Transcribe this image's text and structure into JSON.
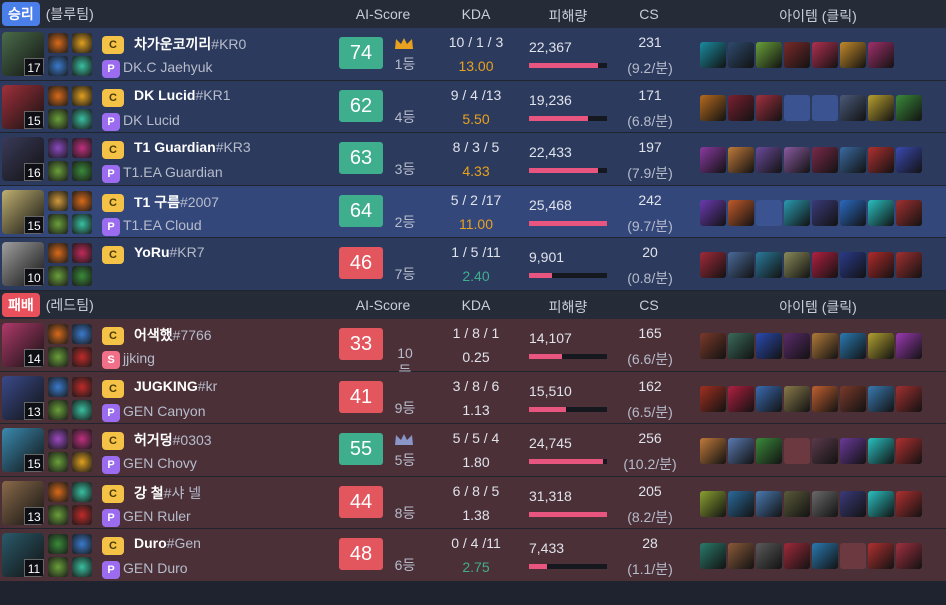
{
  "blue_team": {
    "result": "승리",
    "label": "(블루팀)",
    "headers": {
      "ai": "AI-Score",
      "kda": "KDA",
      "dmg": "피해량",
      "cs": "CS",
      "items": "아이템 (클릭)"
    },
    "players": [
      {
        "level": "17",
        "tier": "C",
        "name": "차가운코끼리",
        "tag": "#KR0",
        "subtier": "P",
        "sub": "DK.C Jaehyuk",
        "score": "74",
        "rank": "1등",
        "crown": "gold",
        "kda": "10 / 1 / 3",
        "ratio": "13.00",
        "ratio_color": "#e8a21f",
        "dmg": "22,367",
        "dmg_frac": 0.88,
        "cs": "231",
        "csm": "(9.2/분)",
        "me": false,
        "items": [
          "#1a8ca0",
          "#2e4a6e",
          "#6aa03a",
          "#7a2a2a",
          "#b03050",
          "#c28a2a",
          "#a0306a"
        ],
        "champ": "#4a6c4a",
        "spells": [
          "#d86a1a",
          "#e0a020",
          "#3a7acc",
          "#3ac0a0"
        ]
      },
      {
        "level": "15",
        "tier": "C",
        "name": "DK Lucid",
        "tag": "#KR1",
        "subtier": "P",
        "sub": "DK Lucid",
        "score": "62",
        "rank": "4등",
        "crown": "",
        "kda": "9 / 4 /13",
        "ratio": "5.50",
        "ratio_color": "#e8a21f",
        "dmg": "19,236",
        "dmg_frac": 0.75,
        "cs": "171",
        "csm": "(6.8/분)",
        "me": false,
        "items": [
          "#b46a1e",
          "#7a2030",
          "#a03040",
          "blank",
          "blank",
          "#4a5a7a",
          "#b8a030",
          "#3a8a3a"
        ],
        "champ": "#a0303a",
        "spells": [
          "#d86a1a",
          "#e0a020",
          "#6aa03a",
          "#3ac0a0"
        ]
      },
      {
        "level": "16",
        "tier": "C",
        "name": "T1 Guardian",
        "tag": "#KR3",
        "subtier": "P",
        "sub": "T1.EA Guardian",
        "score": "63",
        "rank": "3등",
        "crown": "",
        "kda": "8 / 3 / 5",
        "ratio": "4.33",
        "ratio_color": "#e8a21f",
        "dmg": "22,433",
        "dmg_frac": 0.88,
        "cs": "197",
        "csm": "(7.9/분)",
        "me": false,
        "items": [
          "#8a3aa0",
          "#c07a3a",
          "#6a4a9a",
          "#8a5aa0",
          "#7a2a4a",
          "#3a6aa0",
          "#b03030",
          "#3a4ab0"
        ],
        "champ": "#3a3a5a",
        "spells": [
          "#8a4ac0",
          "#c03080",
          "#6aa03a",
          "#3a8a3a"
        ]
      },
      {
        "level": "15",
        "tier": "C",
        "name": "T1 구름",
        "tag": "#2007",
        "subtier": "P",
        "sub": "T1.EA Cloud",
        "score": "64",
        "rank": "2등",
        "crown": "",
        "kda": "5 / 2 /17",
        "ratio": "11.00",
        "ratio_color": "#e8a21f",
        "dmg": "25,468",
        "dmg_frac": 1.0,
        "cs": "242",
        "csm": "(9.7/분)",
        "me": true,
        "items": [
          "#6a3ab0",
          "#c05a2a",
          "blank",
          "#2a9ab0",
          "#3a3a7a",
          "#2a6ac0",
          "#2ac0c0",
          "#a03030"
        ],
        "champ": "#c0b070",
        "spells": [
          "#d09a3a",
          "#d86a1a",
          "#6aa03a",
          "#3ac0a0"
        ]
      },
      {
        "level": "10",
        "tier": "C",
        "name": "YoRu",
        "tag": "#KR7",
        "subtier": "",
        "sub": "",
        "score": "46",
        "rank": "7등",
        "crown": "",
        "kda": "1 / 5 /11",
        "ratio": "2.40",
        "ratio_color": "#3fae8d",
        "dmg": "9,901",
        "dmg_frac": 0.3,
        "cs": "20",
        "csm": "(0.8/분)",
        "me": false,
        "items": [
          "#a02a3a",
          "#4a6a9a",
          "#2a7a9a",
          "#8a8a5a",
          "#b02040",
          "#2a3a8a",
          "#b02a2a",
          "#a03030"
        ],
        "champ": "#a0a0a0",
        "spells": [
          "#d86a1a",
          "#c02a5a",
          "#6aa03a",
          "#3a8a3a"
        ]
      }
    ]
  },
  "red_team": {
    "result": "패배",
    "label": "(레드팀)",
    "headers": {
      "ai": "AI-Score",
      "kda": "KDA",
      "dmg": "피해량",
      "cs": "CS",
      "items": "아이템 (클릭)"
    },
    "players": [
      {
        "level": "14",
        "tier": "C",
        "name": "어색했",
        "tag": "#7766",
        "subtier": "S",
        "sub": "jjking",
        "score": "33",
        "rank": "10등",
        "crown": "",
        "kda": "1 / 8 / 1",
        "ratio": "0.25",
        "ratio_color": "#e0e3ea",
        "dmg": "14,107",
        "dmg_frac": 0.42,
        "cs": "165",
        "csm": "(6.6/분)",
        "me": false,
        "items": [
          "#7a3a2a",
          "#3a6a5a",
          "#2a4ab0",
          "#5a2a6a",
          "#b07a3a",
          "#2a7ab0",
          "#b0a030",
          "#9a3ab0"
        ],
        "champ": "#b03a6a",
        "spells": [
          "#d86a1a",
          "#3a7acc",
          "#6aa03a",
          "#c02a2a"
        ]
      },
      {
        "level": "13",
        "tier": "C",
        "name": "JUGKING",
        "tag": "#kr",
        "subtier": "P",
        "sub": "GEN Canyon",
        "score": "41",
        "rank": "9등",
        "crown": "",
        "kda": "3 / 8 / 6",
        "ratio": "1.13",
        "ratio_color": "#e0e3ea",
        "dmg": "15,510",
        "dmg_frac": 0.48,
        "cs": "162",
        "csm": "(6.5/분)",
        "me": false,
        "items": [
          "#a03020",
          "#b02040",
          "#3a6ab0",
          "#8a7a4a",
          "#c06030",
          "#7a3a2a",
          "#3a7ab0",
          "#a03030"
        ],
        "champ": "#3a4a8a",
        "spells": [
          "#3a7acc",
          "#c02a2a",
          "#6aa03a",
          "#3ac0a0"
        ]
      },
      {
        "level": "15",
        "tier": "C",
        "name": "허거덩",
        "tag": "#0303",
        "subtier": "P",
        "sub": "GEN Chovy",
        "score": "55",
        "rank": "5등",
        "crown": "silver",
        "kda": "5 / 5 / 4",
        "ratio": "1.80",
        "ratio_color": "#e0e3ea",
        "dmg": "24,745",
        "dmg_frac": 0.95,
        "cs": "256",
        "csm": "(10.2/분)",
        "me": false,
        "items": [
          "#c07a3a",
          "#5a7ab0",
          "#3a8a3a",
          "blank",
          "#5a3a4a",
          "#6a3a9a",
          "#2ac0c0",
          "#b03030"
        ],
        "champ": "#3a8ab0",
        "spells": [
          "#9a4ac0",
          "#c03080",
          "#6aa03a",
          "#e0a020"
        ]
      },
      {
        "level": "13",
        "tier": "C",
        "name": "강 철",
        "tag": "#샤 넬",
        "subtier": "P",
        "sub": "GEN Ruler",
        "score": "44",
        "rank": "8등",
        "crown": "",
        "kda": "6 / 8 / 5",
        "ratio": "1.38",
        "ratio_color": "#e0e3ea",
        "dmg": "31,318",
        "dmg_frac": 1.0,
        "cs": "205",
        "csm": "(8.2/분)",
        "me": false,
        "items": [
          "#8aa030",
          "#2a6a9a",
          "#4a7ab0",
          "#5a5a3a",
          "#6a6a6a",
          "#3a3a7a",
          "#2ac0c0",
          "#b03030"
        ],
        "champ": "#8a6a4a",
        "spells": [
          "#d86a1a",
          "#3ac0a0",
          "#6aa03a",
          "#c02a2a"
        ]
      },
      {
        "level": "11",
        "tier": "C",
        "name": "Duro",
        "tag": "#Gen",
        "subtier": "P",
        "sub": "GEN Duro",
        "score": "48",
        "rank": "6등",
        "crown": "",
        "kda": "0 / 4 /11",
        "ratio": "2.75",
        "ratio_color": "#3fae8d",
        "dmg": "7,433",
        "dmg_frac": 0.23,
        "cs": "28",
        "csm": "(1.1/분)",
        "me": false,
        "items": [
          "#2a7a6a",
          "#8a5a3a",
          "#5a5a5a",
          "#a02a3a",
          "#2a7ab0",
          "blank",
          "#b03030",
          "#a03040"
        ],
        "champ": "#2a5a6a",
        "spells": [
          "#3a8a3a",
          "#3a7acc",
          "#6aa03a",
          "#3ac0a0"
        ]
      }
    ]
  }
}
